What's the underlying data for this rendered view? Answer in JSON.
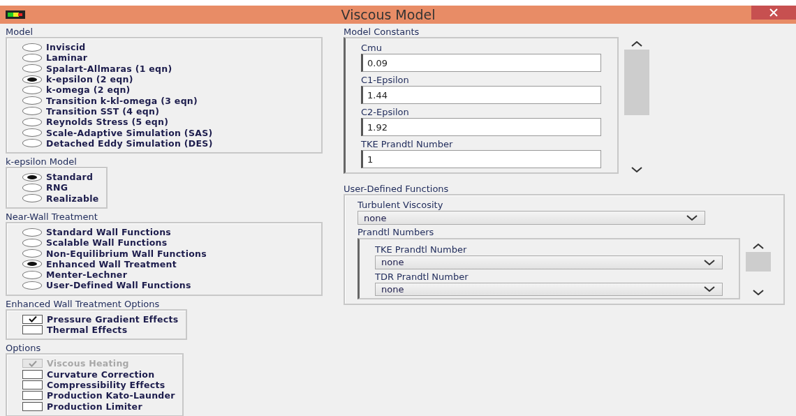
{
  "window": {
    "title": "Viscous Model"
  },
  "left_sections": [
    {
      "title": "Model",
      "kind": "radio",
      "items": [
        {
          "label": "Inviscid",
          "selected": false
        },
        {
          "label": "Laminar",
          "selected": false
        },
        {
          "label": "Spalart-Allmaras (1 eqn)",
          "selected": false
        },
        {
          "label": "k-epsilon (2 eqn)",
          "selected": true
        },
        {
          "label": "k-omega (2 eqn)",
          "selected": false
        },
        {
          "label": "Transition k-kl-omega (3 eqn)",
          "selected": false
        },
        {
          "label": "Transition SST (4 eqn)",
          "selected": false
        },
        {
          "label": "Reynolds Stress (5 eqn)",
          "selected": false
        },
        {
          "label": "Scale-Adaptive Simulation (SAS)",
          "selected": false
        },
        {
          "label": "Detached Eddy Simulation (DES)",
          "selected": false
        }
      ]
    },
    {
      "title": "k-epsilon Model",
      "kind": "radio",
      "items": [
        {
          "label": "Standard",
          "selected": true
        },
        {
          "label": "RNG",
          "selected": false
        },
        {
          "label": "Realizable",
          "selected": false
        }
      ]
    },
    {
      "title": "Near-Wall Treatment",
      "kind": "radio",
      "items": [
        {
          "label": "Standard Wall Functions",
          "selected": false
        },
        {
          "label": "Scalable Wall Functions",
          "selected": false
        },
        {
          "label": "Non-Equilibrium Wall Functions",
          "selected": false
        },
        {
          "label": "Enhanced Wall Treatment",
          "selected": true
        },
        {
          "label": "Menter-Lechner",
          "selected": false
        },
        {
          "label": "User-Defined Wall Functions",
          "selected": false
        }
      ]
    },
    {
      "title": "Enhanced Wall Treatment Options",
      "kind": "checkbox",
      "items": [
        {
          "label": "Pressure Gradient Effects",
          "checked": true,
          "disabled": false
        },
        {
          "label": "Thermal Effects",
          "checked": false,
          "disabled": false
        }
      ]
    },
    {
      "title": "Options",
      "kind": "checkbox",
      "items": [
        {
          "label": "Viscous Heating",
          "checked": true,
          "disabled": true
        },
        {
          "label": "Curvature Correction",
          "checked": false,
          "disabled": false
        },
        {
          "label": "Compressibility Effects",
          "checked": false,
          "disabled": false
        },
        {
          "label": "Production Kato-Launder",
          "checked": false,
          "disabled": false
        },
        {
          "label": "Production Limiter",
          "checked": false,
          "disabled": false
        }
      ]
    }
  ],
  "model_constants": {
    "title": "Model Constants",
    "fields": [
      {
        "label": "Cmu",
        "value": "0.09"
      },
      {
        "label": "C1-Epsilon",
        "value": "1.44"
      },
      {
        "label": "C2-Epsilon",
        "value": "1.92"
      },
      {
        "label": "TKE Prandtl Number",
        "value": "1"
      }
    ]
  },
  "user_defined_functions": {
    "title": "User-Defined Functions",
    "turbulent_viscosity": {
      "label": "Turbulent Viscosity",
      "value": "none"
    },
    "prandtl_numbers": {
      "title": "Prandtl Numbers",
      "selects": [
        {
          "label": "TKE Prandtl Number",
          "value": "none"
        },
        {
          "label": "TDR Prandtl Number",
          "value": "none"
        }
      ]
    }
  }
}
